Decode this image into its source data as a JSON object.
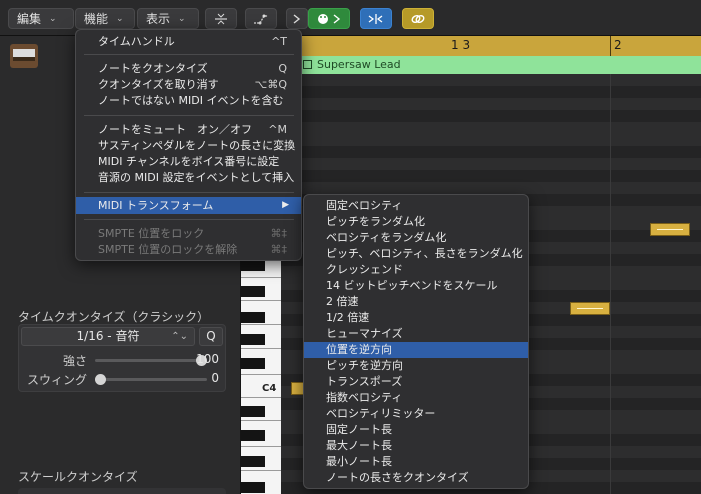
{
  "toolbar": {
    "edit_menu": "編集",
    "function_menu": "機能",
    "view_menu": "表示",
    "chevron": "⌄"
  },
  "inspector": {
    "time_quantize_title": "タイムクオンタイズ（クラシック）",
    "quantize_value": "1/16 - 音符",
    "q_button": "Q",
    "strength_label": "強さ",
    "strength_value": "100",
    "strength_level": 1.0,
    "swing_label": "スウィング",
    "swing_value": "0",
    "swing_level": 0.0,
    "scale_quantize_title": "スケールクオンタイズ"
  },
  "piano": {
    "c4_label": "C4"
  },
  "editor": {
    "ruler_marks": [
      "1 3",
      "2"
    ],
    "region_name": "Supersaw Lead"
  },
  "function_menu": {
    "items": [
      {
        "label": "タイムハンドル",
        "shortcut": "^T"
      },
      {
        "label": "ノートをクオンタイズ",
        "shortcut": "Q"
      },
      {
        "label": "クオンタイズを取り消す",
        "shortcut": "⌥⌘Q"
      },
      {
        "label": "ノートではない MIDI イベントを含む",
        "shortcut": ""
      },
      {
        "label": "ノートをミュート　オン／オフ",
        "shortcut": "^M"
      },
      {
        "label": "サスティンペダルをノートの長さに変換",
        "shortcut": ""
      },
      {
        "label": "MIDI チャンネルをボイス番号に設定",
        "shortcut": ""
      },
      {
        "label": "音源の MIDI 設定をイベントとして挿入",
        "shortcut": ""
      },
      {
        "label": "MIDI トランスフォーム",
        "shortcut": "▶"
      },
      {
        "label": "SMPTE 位置をロック",
        "shortcut": "⌘‡"
      },
      {
        "label": "SMPTE 位置のロックを解除",
        "shortcut": "⌘‡"
      }
    ]
  },
  "transform_submenu": {
    "items": [
      "固定ベロシティ",
      "ピッチをランダム化",
      "ベロシティをランダム化",
      "ピッチ、ベロシティ、長さをランダム化",
      "クレッシェンド",
      "14 ビットピッチベンドをスケール",
      "2 倍速",
      "1/2 倍速",
      "ヒューマナイズ",
      "位置を逆方向",
      "ピッチを逆方向",
      "トランスポーズ",
      "指数ベロシティ",
      "ベロシティリミッター",
      "固定ノート長",
      "最大ノート長",
      "最小ノート長",
      "ノートの長さをクオンタイズ"
    ]
  }
}
